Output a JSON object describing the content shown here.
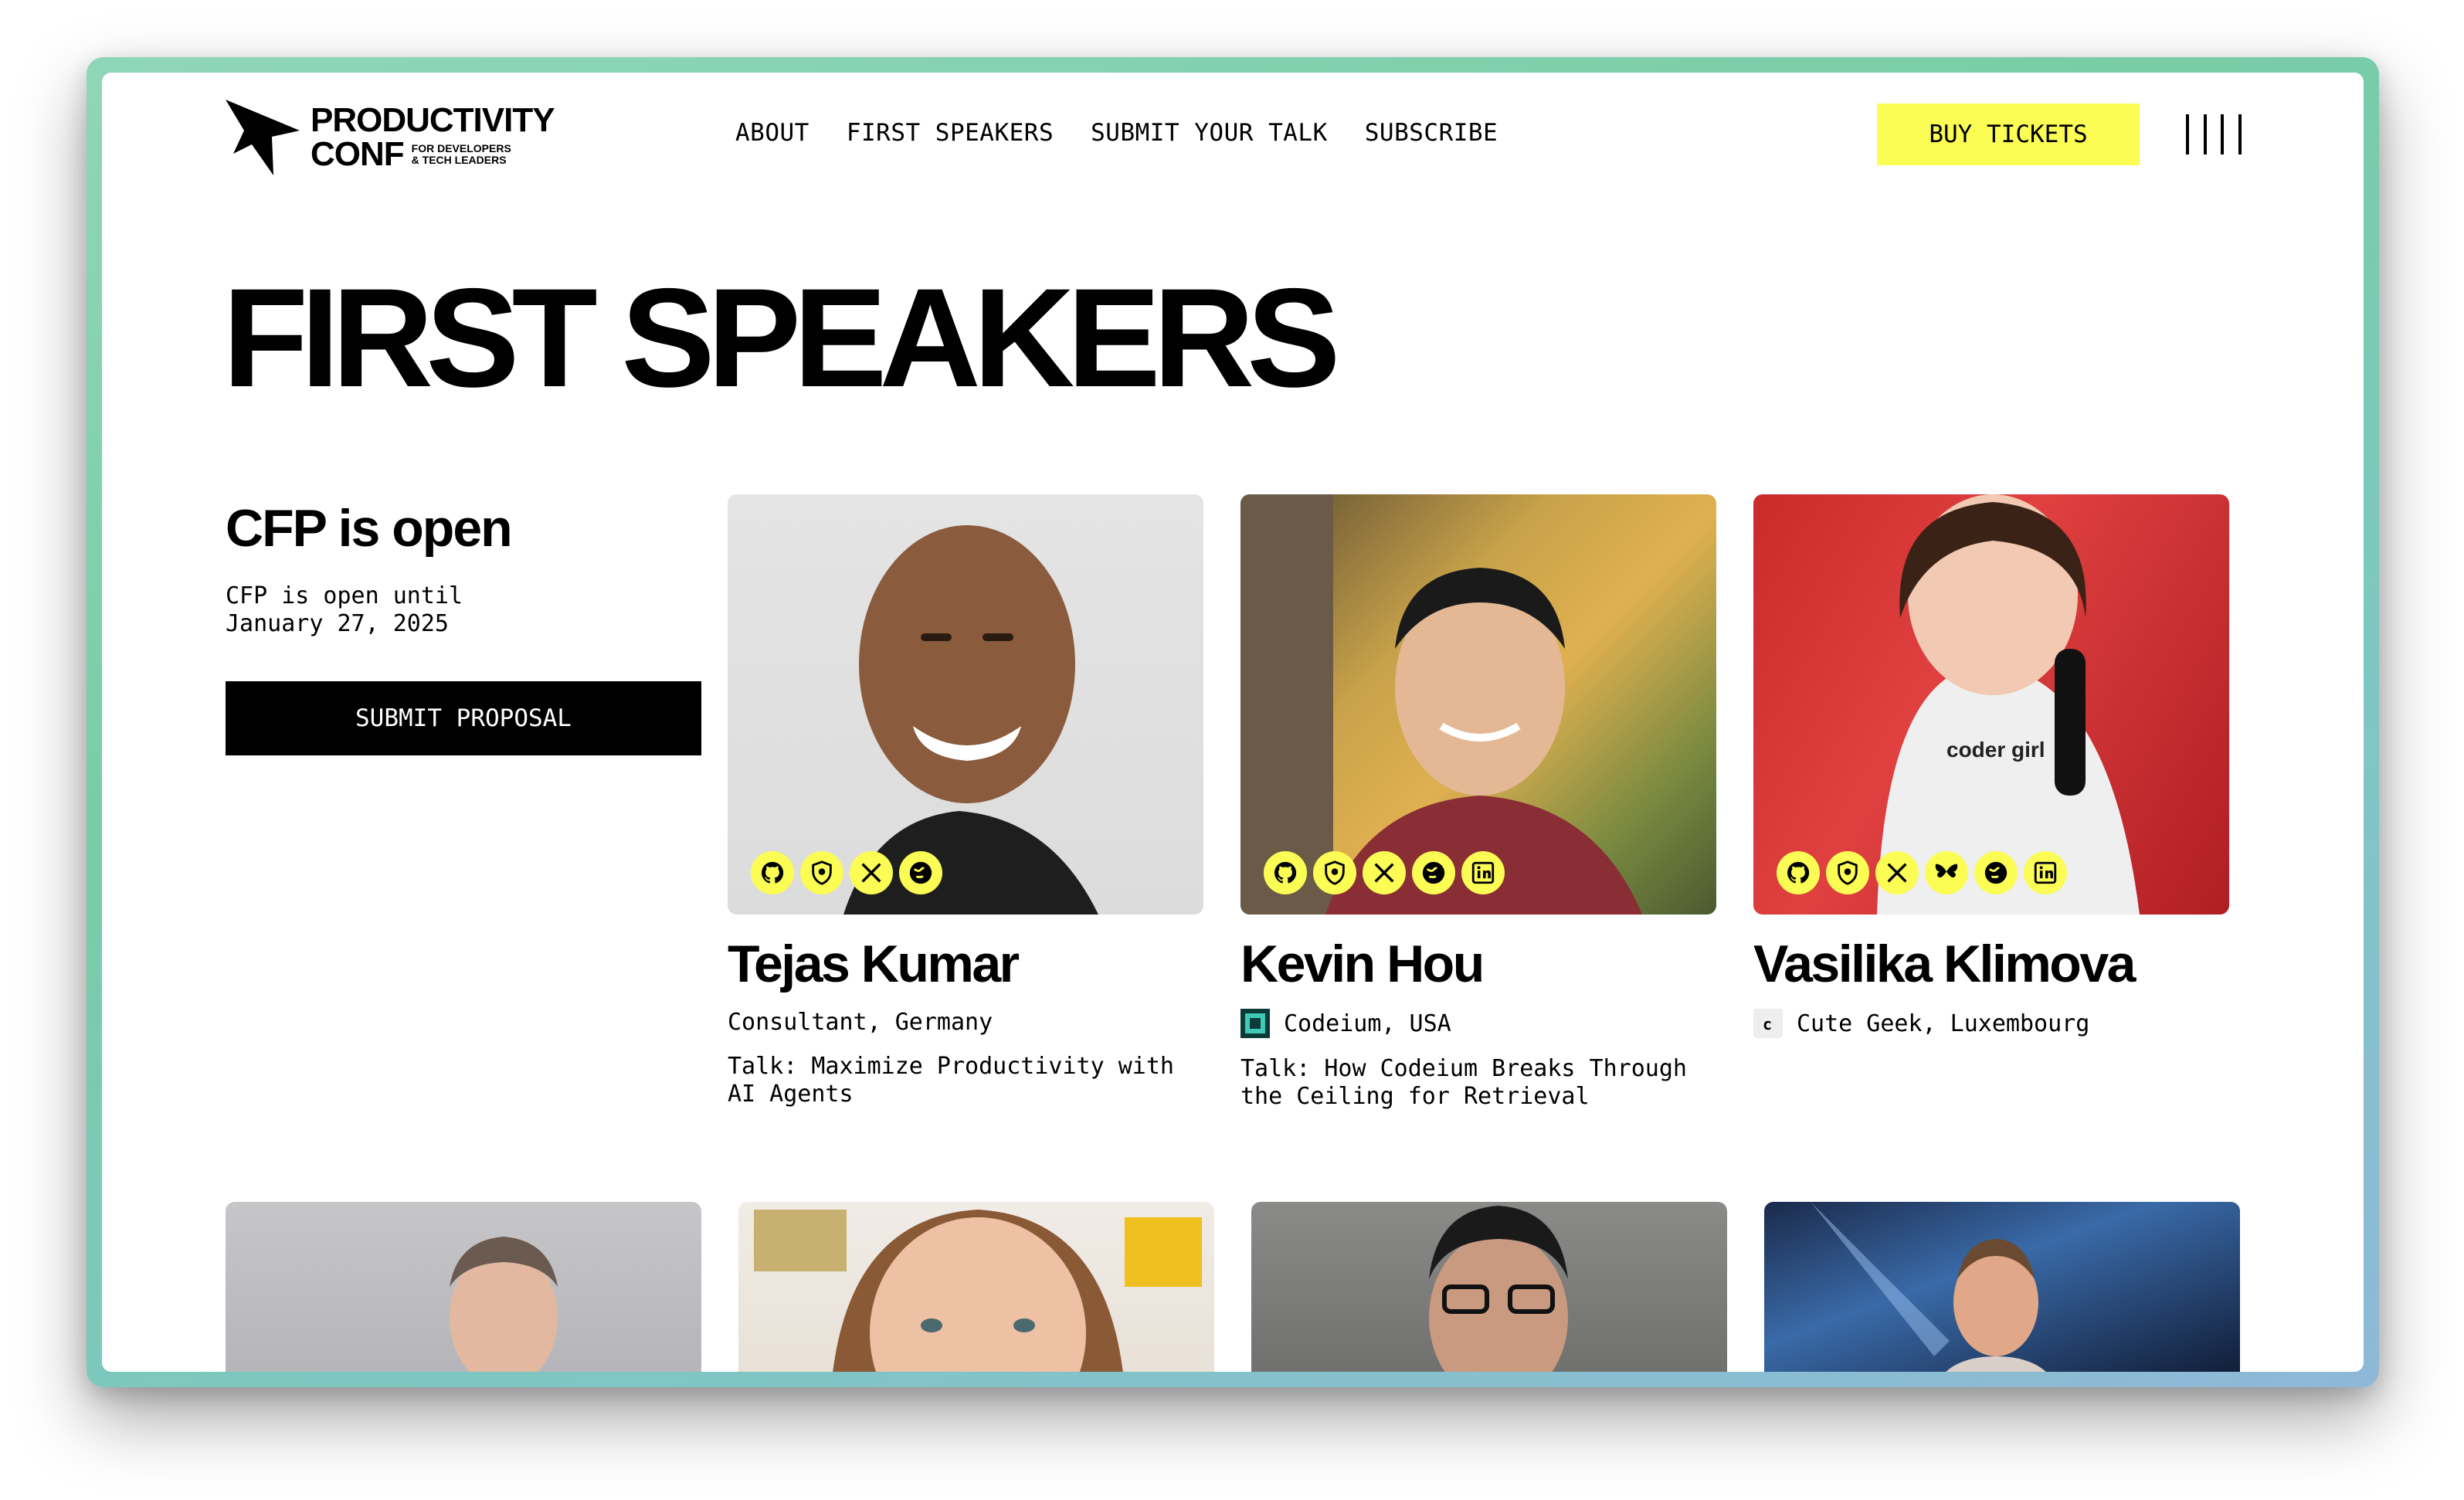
{
  "logo": {
    "line1": "PRODUCTIVITY",
    "line2": "CONF",
    "tagline1": "FOR DEVELOPERS",
    "tagline2": "& TECH LEADERS"
  },
  "nav": {
    "items": [
      "ABOUT",
      "FIRST SPEAKERS",
      "SUBMIT YOUR TALK",
      "SUBSCRIBE"
    ]
  },
  "buy_tickets": "BUY TICKETS",
  "page_title": "FIRST SPEAKERS",
  "cfp": {
    "title": "CFP is open",
    "line1": "CFP is open until",
    "line2": "January 27, 2025",
    "button": "SUBMIT PROPOSAL"
  },
  "speakers": [
    {
      "name": "Tejas Kumar",
      "affiliation": "Consultant, Germany",
      "talk": "Talk: Maximize Productivity with AI Agents",
      "socials": [
        "github-icon",
        "shield-icon",
        "x-icon",
        "globe-icon"
      ]
    },
    {
      "name": "Kevin Hou",
      "affiliation": "Codeium, USA",
      "talk": "Talk: How Codeium Breaks Through the Ceiling for Retrieval",
      "socials": [
        "github-icon",
        "shield-icon",
        "x-icon",
        "globe-icon",
        "linkedin-icon"
      ]
    },
    {
      "name": "Vasilika Klimova",
      "affiliation": "Cute Geek, Luxembourg",
      "talk": "",
      "socials": [
        "github-icon",
        "shield-icon",
        "x-icon",
        "butterfly-icon",
        "globe-icon",
        "linkedin-icon"
      ]
    }
  ],
  "colors": {
    "accent": "#fbfc54",
    "text": "#000000",
    "frame": "#7fcfad"
  }
}
